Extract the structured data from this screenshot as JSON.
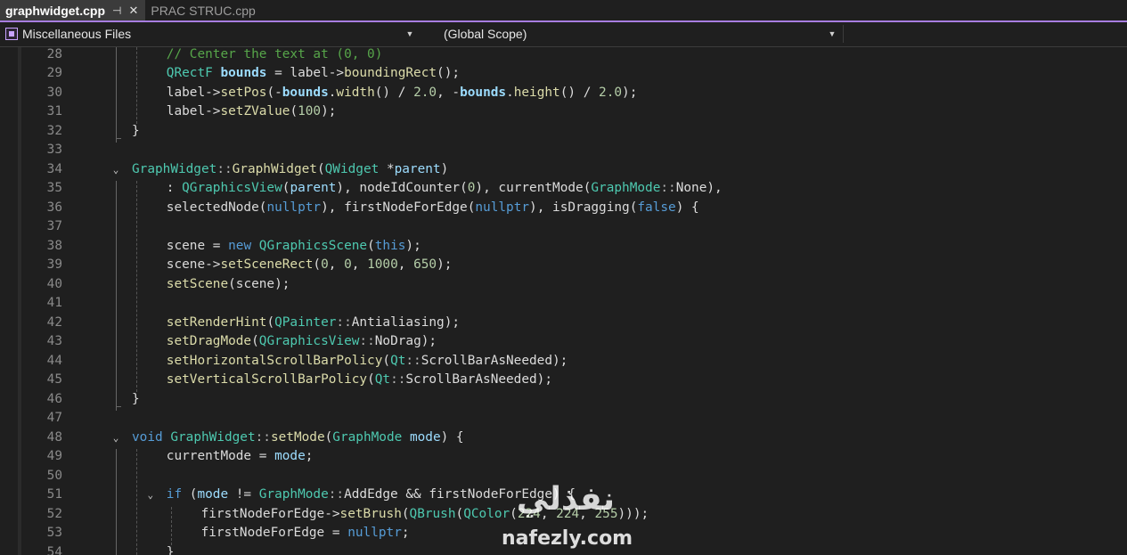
{
  "tabs": [
    {
      "label": "graphwidget.cpp",
      "active": true,
      "pin_icon": "pin-icon",
      "close_icon": "close-icon"
    },
    {
      "label": "PRAC STRUC.cpp",
      "active": false
    }
  ],
  "navbar": {
    "project": "Miscellaneous Files",
    "scope": "(Global Scope)",
    "member": ""
  },
  "colors": {
    "tab_accent": "#a77de0",
    "background": "#1f1f1f",
    "comment": "#57a64a",
    "keyword": "#569cd6",
    "type": "#4ec9b0",
    "function": "#dcdcaa",
    "number": "#b5cea8"
  },
  "code_lines": [
    {
      "n": "28",
      "tokens": [
        [
          "cm",
          "// Center the text at (0, 0)"
        ]
      ],
      "indent": 1
    },
    {
      "n": "29",
      "tokens": [
        [
          "ty",
          "QRectF"
        ],
        [
          "id",
          " "
        ],
        [
          "bold",
          "bounds"
        ],
        [
          "id",
          " = label->"
        ],
        [
          "fn",
          "boundingRect"
        ],
        [
          "id",
          "();"
        ]
      ],
      "indent": 1
    },
    {
      "n": "30",
      "tokens": [
        [
          "id",
          "label->"
        ],
        [
          "fn",
          "setPos"
        ],
        [
          "id",
          "(-"
        ],
        [
          "bold",
          "bounds"
        ],
        [
          "id",
          "."
        ],
        [
          "fn",
          "width"
        ],
        [
          "id",
          "() / "
        ],
        [
          "nu",
          "2.0"
        ],
        [
          "id",
          ", -"
        ],
        [
          "bold",
          "bounds"
        ],
        [
          "id",
          "."
        ],
        [
          "fn",
          "height"
        ],
        [
          "id",
          "() / "
        ],
        [
          "nu",
          "2.0"
        ],
        [
          "id",
          ");"
        ]
      ],
      "indent": 1
    },
    {
      "n": "31",
      "tokens": [
        [
          "id",
          "label->"
        ],
        [
          "fn",
          "setZValue"
        ],
        [
          "id",
          "("
        ],
        [
          "nu",
          "100"
        ],
        [
          "id",
          ");"
        ]
      ],
      "indent": 1
    },
    {
      "n": "32",
      "tokens": [
        [
          "id",
          "}"
        ]
      ],
      "indent": 0
    },
    {
      "n": "33",
      "tokens": [],
      "indent": 0
    },
    {
      "n": "34",
      "tokens": [
        [
          "ty",
          "GraphWidget"
        ],
        [
          "op",
          "::"
        ],
        [
          "fn",
          "GraphWidget"
        ],
        [
          "id",
          "("
        ],
        [
          "ty",
          "QWidget"
        ],
        [
          "id",
          " *"
        ],
        [
          "pm",
          "parent"
        ],
        [
          "id",
          ")"
        ]
      ],
      "indent": 0,
      "fold": true
    },
    {
      "n": "35",
      "tokens": [
        [
          "id",
          ": "
        ],
        [
          "ty",
          "QGraphicsView"
        ],
        [
          "id",
          "("
        ],
        [
          "pm",
          "parent"
        ],
        [
          "id",
          "), "
        ],
        [
          "mb",
          "nodeIdCounter"
        ],
        [
          "id",
          "("
        ],
        [
          "nu",
          "0"
        ],
        [
          "id",
          "), "
        ],
        [
          "mb",
          "currentMode"
        ],
        [
          "id",
          "("
        ],
        [
          "ty",
          "GraphMode"
        ],
        [
          "op",
          "::"
        ],
        [
          "id",
          "None),"
        ]
      ],
      "indent": 1
    },
    {
      "n": "36",
      "tokens": [
        [
          "mb",
          "selectedNode"
        ],
        [
          "id",
          "("
        ],
        [
          "kw",
          "nullptr"
        ],
        [
          "id",
          "), "
        ],
        [
          "mb",
          "firstNodeForEdge"
        ],
        [
          "id",
          "("
        ],
        [
          "kw",
          "nullptr"
        ],
        [
          "id",
          "), "
        ],
        [
          "mb",
          "isDragging"
        ],
        [
          "id",
          "("
        ],
        [
          "kw",
          "false"
        ],
        [
          "id",
          ") {"
        ]
      ],
      "indent": 1
    },
    {
      "n": "37",
      "tokens": [],
      "indent": 1
    },
    {
      "n": "38",
      "tokens": [
        [
          "mb",
          "scene"
        ],
        [
          "id",
          " = "
        ],
        [
          "kw",
          "new"
        ],
        [
          "id",
          " "
        ],
        [
          "ty",
          "QGraphicsScene"
        ],
        [
          "id",
          "("
        ],
        [
          "kw",
          "this"
        ],
        [
          "id",
          ");"
        ]
      ],
      "indent": 1
    },
    {
      "n": "39",
      "tokens": [
        [
          "mb",
          "scene"
        ],
        [
          "id",
          "->"
        ],
        [
          "fn",
          "setSceneRect"
        ],
        [
          "id",
          "("
        ],
        [
          "nu",
          "0"
        ],
        [
          "id",
          ", "
        ],
        [
          "nu",
          "0"
        ],
        [
          "id",
          ", "
        ],
        [
          "nu",
          "1000"
        ],
        [
          "id",
          ", "
        ],
        [
          "nu",
          "650"
        ],
        [
          "id",
          ");"
        ]
      ],
      "indent": 1
    },
    {
      "n": "40",
      "tokens": [
        [
          "fn",
          "setScene"
        ],
        [
          "id",
          "("
        ],
        [
          "mb",
          "scene"
        ],
        [
          "id",
          ");"
        ]
      ],
      "indent": 1
    },
    {
      "n": "41",
      "tokens": [],
      "indent": 1
    },
    {
      "n": "42",
      "tokens": [
        [
          "fn",
          "setRenderHint"
        ],
        [
          "id",
          "("
        ],
        [
          "ty",
          "QPainter"
        ],
        [
          "op",
          "::"
        ],
        [
          "id",
          "Antialiasing);"
        ]
      ],
      "indent": 1
    },
    {
      "n": "43",
      "tokens": [
        [
          "fn",
          "setDragMode"
        ],
        [
          "id",
          "("
        ],
        [
          "ty",
          "QGraphicsView"
        ],
        [
          "op",
          "::"
        ],
        [
          "id",
          "NoDrag);"
        ]
      ],
      "indent": 1
    },
    {
      "n": "44",
      "tokens": [
        [
          "fn",
          "setHorizontalScrollBarPolicy"
        ],
        [
          "id",
          "("
        ],
        [
          "ty",
          "Qt"
        ],
        [
          "op",
          "::"
        ],
        [
          "id",
          "ScrollBarAsNeeded);"
        ]
      ],
      "indent": 1
    },
    {
      "n": "45",
      "tokens": [
        [
          "fn",
          "setVerticalScrollBarPolicy"
        ],
        [
          "id",
          "("
        ],
        [
          "ty",
          "Qt"
        ],
        [
          "op",
          "::"
        ],
        [
          "id",
          "ScrollBarAsNeeded);"
        ]
      ],
      "indent": 1
    },
    {
      "n": "46",
      "tokens": [
        [
          "id",
          "}"
        ]
      ],
      "indent": 0
    },
    {
      "n": "47",
      "tokens": [],
      "indent": 0
    },
    {
      "n": "48",
      "tokens": [
        [
          "kw",
          "void"
        ],
        [
          "id",
          " "
        ],
        [
          "ty",
          "GraphWidget"
        ],
        [
          "op",
          "::"
        ],
        [
          "fn",
          "setMode"
        ],
        [
          "id",
          "("
        ],
        [
          "ty",
          "GraphMode"
        ],
        [
          "id",
          " "
        ],
        [
          "pm",
          "mode"
        ],
        [
          "id",
          ") {"
        ]
      ],
      "indent": 0,
      "fold": true
    },
    {
      "n": "49",
      "tokens": [
        [
          "mb",
          "currentMode"
        ],
        [
          "id",
          " = "
        ],
        [
          "pm",
          "mode"
        ],
        [
          "id",
          ";"
        ]
      ],
      "indent": 1
    },
    {
      "n": "50",
      "tokens": [],
      "indent": 1
    },
    {
      "n": "51",
      "tokens": [
        [
          "kw",
          "if"
        ],
        [
          "id",
          " ("
        ],
        [
          "pm",
          "mode"
        ],
        [
          "id",
          " != "
        ],
        [
          "ty",
          "GraphMode"
        ],
        [
          "op",
          "::"
        ],
        [
          "id",
          "AddEdge && "
        ],
        [
          "mb",
          "firstNodeForEdge"
        ],
        [
          "id",
          ") {"
        ]
      ],
      "indent": 1,
      "fold": true
    },
    {
      "n": "52",
      "tokens": [
        [
          "mb",
          "firstNodeForEdge"
        ],
        [
          "id",
          "->"
        ],
        [
          "fn",
          "setBrush"
        ],
        [
          "id",
          "("
        ],
        [
          "ty",
          "QBrush"
        ],
        [
          "id",
          "("
        ],
        [
          "ty",
          "QColor"
        ],
        [
          "id",
          "("
        ],
        [
          "nu",
          "224"
        ],
        [
          "id",
          ", "
        ],
        [
          "nu",
          "224"
        ],
        [
          "id",
          ", "
        ],
        [
          "nu",
          "255"
        ],
        [
          "id",
          ")));"
        ]
      ],
      "indent": 2
    },
    {
      "n": "53",
      "tokens": [
        [
          "mb",
          "firstNodeForEdge"
        ],
        [
          "id",
          " = "
        ],
        [
          "kw",
          "nullptr"
        ],
        [
          "id",
          ";"
        ]
      ],
      "indent": 2
    },
    {
      "n": "54",
      "tokens": [
        [
          "id",
          "}"
        ]
      ],
      "indent": 1
    }
  ],
  "watermark": {
    "arabic": "نفذلي",
    "latin": "nafezly.com"
  }
}
